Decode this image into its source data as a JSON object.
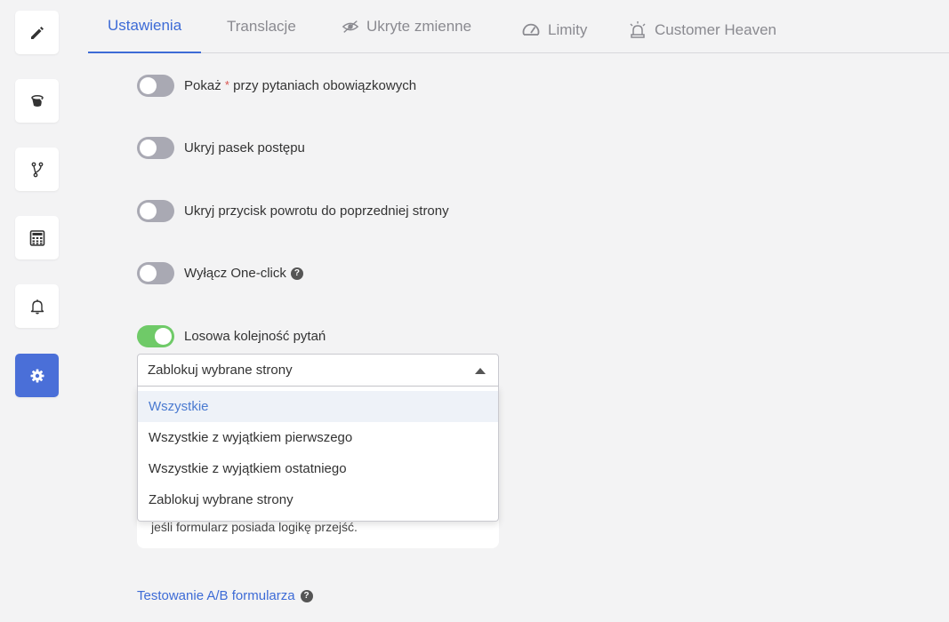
{
  "sidebar": {
    "items": [
      {
        "icon": "pencil-icon",
        "active": false
      },
      {
        "icon": "paint-bucket-icon",
        "active": false
      },
      {
        "icon": "branch-icon",
        "active": false
      },
      {
        "icon": "calculator-icon",
        "active": false
      },
      {
        "icon": "bell-icon",
        "active": false
      },
      {
        "icon": "gear-icon",
        "active": true
      }
    ]
  },
  "tabs": [
    {
      "label": "Ustawienia",
      "active": true
    },
    {
      "label": "Translacje"
    },
    {
      "label": "Ukryte zmienne",
      "icon": "eye-slash-icon"
    },
    {
      "label": "Limity",
      "icon": "speedometer-icon"
    },
    {
      "label": "Customer Heaven",
      "icon": "alarm-light-icon"
    }
  ],
  "settings": {
    "required_prefix": "Pokaż",
    "required_mark": "*",
    "required_suffix": "przy pytaniach obowiązkowych",
    "hide_progress": "Ukryj pasek postępu",
    "hide_back": "Ukryj przycisk powrotu do poprzedniej strony",
    "disable_oneclick": "Wyłącz One-click",
    "random_order": "Losowa kolejność pytań"
  },
  "toggles": {
    "required": false,
    "progress": false,
    "back": false,
    "oneclick": false,
    "random": true
  },
  "select": {
    "value": "Zablokuj wybrane strony",
    "options": [
      "Wszystkie",
      "Wszystkie z wyjątkiem pierwszego",
      "Wszystkie z wyjątkiem ostatniego",
      "Zablokuj wybrane strony"
    ],
    "highlighted": "Wszystkie"
  },
  "info_text": "jeśli formularz posiada logikę przejść.",
  "ab_link": "Testowanie A/B formularza",
  "help_glyph": "?",
  "colors": {
    "accent": "#3d6bd6",
    "toggle_on": "#6fca68",
    "toggle_off": "#a9a9b3",
    "sidebar_active": "#4a6fd8"
  }
}
